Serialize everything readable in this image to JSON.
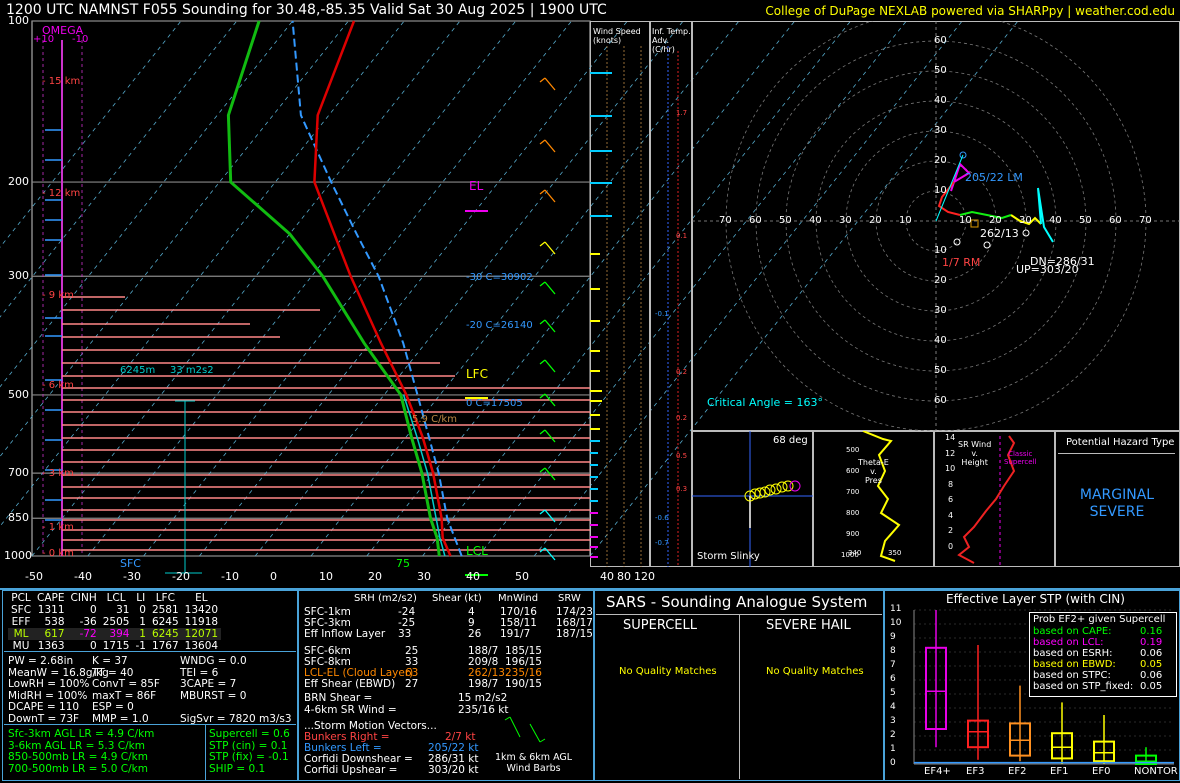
{
  "header": {
    "title": "1200 UTC NAMNST F055 Sounding for 30.48,-85.35 Valid  Sat 30 Aug 2025 | 1900 UTC",
    "credit": "College of DuPage NEXLAB powered via SHARPpy | weather.cod.edu"
  },
  "skewt": {
    "pressure_ticks": [
      "100",
      "200",
      "300",
      "500",
      "700",
      "850",
      "1000"
    ],
    "temp_ticks": [
      "-50",
      "-40",
      "-30",
      "-20",
      "-10",
      "0",
      "10",
      "20",
      "30",
      "40",
      "50"
    ],
    "sfc_label": "SFC",
    "sfc_temp": "75",
    "omega_title": "OMEGA",
    "omega_left": "+10",
    "omega_right": "-10",
    "height_labels": [
      "15 km",
      "12 km",
      "9 km",
      "6 km",
      "3 km",
      "1 km",
      "0 km"
    ],
    "labels": {
      "el": "EL",
      "lfc": "LFC",
      "lcl": "LCL",
      "m30": "-30 C=30902",
      "m20": "-20 C=26140",
      "zero": "0 C=17505",
      "lapse": "5.9 C/km",
      "inflow_depth": "6245m",
      "inflow_srh": "33 m2s2",
      "hail_ticks": [
        "0",
        "10",
        "20",
        "30",
        "30"
      ]
    }
  },
  "wind_speed_panel": {
    "title": "Wind Speed\n(knots)",
    "ticks": [
      "40",
      "80",
      "120"
    ]
  },
  "temp_adv_panel": {
    "title": "Inf. Temp. Adv. (C/hr)",
    "values": [
      "1.7",
      "0.1",
      "-0.1",
      "0.2",
      "0.2",
      "0.5",
      "0.3",
      "-0.6",
      "-0.7"
    ]
  },
  "hodograph": {
    "ring_labels": [
      "60",
      "50",
      "40",
      "30",
      "20",
      "10",
      "10",
      "20",
      "30",
      "40",
      "50",
      "60"
    ],
    "axis_labels": [
      "70",
      "60",
      "50",
      "40",
      "30",
      "20",
      "10",
      "10",
      "20",
      "30",
      "40",
      "50",
      "60",
      "70"
    ],
    "lm": "205/22 LM",
    "mean": "262/13",
    "rm": "1/7 RM",
    "up": "UP=303/20",
    "dn": "DN=286/31",
    "critical_angle": "Critical Angle = 163°"
  },
  "slinky": {
    "title": "Storm Slinky",
    "deg": "68 deg"
  },
  "theta": {
    "title": "Theta-E\nv.\nPres",
    "ticks": [
      "500",
      "600",
      "700",
      "800",
      "900",
      "1000"
    ],
    "xticks": [
      "340",
      "350"
    ]
  },
  "srwind": {
    "title": "SR Wind\nv.\nHeight",
    "ticks": [
      "14",
      "12",
      "10",
      "8",
      "6",
      "4",
      "2",
      "0"
    ],
    "classic": "Classic\nSupercell"
  },
  "hazard": {
    "title": "Potential Hazard Type",
    "value": "MARGINAL\nSEVERE"
  },
  "thermo_table": {
    "headers": [
      "PCL",
      "CAPE",
      "CINH",
      "LCL",
      "LI",
      "LFC",
      "EL"
    ],
    "rows": [
      [
        "SFC",
        "1311",
        "0",
        "31",
        "0",
        "2581",
        "13420"
      ],
      [
        "EFF",
        "538",
        "-36",
        "2505",
        "1",
        "6245",
        "11918"
      ],
      [
        "ML",
        "617",
        "-72",
        "394",
        "1",
        "6245",
        "12071"
      ],
      [
        "MU",
        "1363",
        "0",
        "1715",
        "-1",
        "1767",
        "13604"
      ]
    ]
  },
  "thermo_params": [
    [
      "PW = 2.68in",
      "K = 37",
      "WNDG = 0.0"
    ],
    [
      "MeanW = 16.8g/kg",
      "TT = 40",
      "TEI = 6"
    ],
    [
      "LowRH = 100%",
      "ConvT = 85F",
      "3CAPE = 7"
    ],
    [
      "MidRH = 100%",
      "maxT = 86F",
      "MBURST = 0"
    ],
    [
      "DCAPE = 110",
      "ESP = 0",
      ""
    ],
    [
      "DownT = 73F",
      "MMP = 1.0",
      "SigSvr = 7820 m3/s3"
    ]
  ],
  "lapse_rates": [
    "Sfc-3km AGL LR = 4.9 C/km",
    "3-6km AGL LR = 5.3 C/km",
    "850-500mb LR = 4.9 C/km",
    "700-500mb LR = 5.0 C/km"
  ],
  "composite": [
    "Supercell = 0.6",
    "STP (cin) = 0.1",
    "STP (fix) = -0.1",
    "SHIP = 0.1"
  ],
  "kin_table": {
    "headers": [
      "SRH (m2/s2)",
      "Shear (kt)",
      "MnWind",
      "SRW"
    ],
    "rows": [
      [
        "SFC-1km",
        "-24",
        "4",
        "170/16",
        "174/23"
      ],
      [
        "SFC-3km",
        "-25",
        "9",
        "158/11",
        "168/17"
      ],
      [
        "Eff Inflow Layer",
        "33",
        "26",
        "191/7",
        "187/15"
      ],
      [
        "SFC-6km",
        "25",
        "188/7",
        "185/15",
        ""
      ],
      [
        "SFC-8km",
        "33",
        "209/8",
        "196/15",
        ""
      ],
      [
        "LCL-EL (Cloud Layer)",
        "63",
        "262/13",
        "235/16",
        ""
      ],
      [
        "Eff Shear (EBWD)",
        "27",
        "198/7",
        "190/15",
        ""
      ]
    ]
  },
  "kin_extra": {
    "brn": "BRN Shear =",
    "brn_v": "15 m2/s2",
    "srw46": "4-6km SR Wind =",
    "srw46_v": "235/16 kt",
    "motion_title": "...Storm Motion Vectors...",
    "br": "Bunkers Right =",
    "br_v": "2/7 kt",
    "bl": "Bunkers Left =",
    "bl_v": "205/22 kt",
    "cd": "Corfidi Downshear =",
    "cd_v": "286/31 kt",
    "cu": "Corfidi Upshear =",
    "cu_v": "303/20 kt",
    "barbs": "1km & 6km AGL\nWind Barbs"
  },
  "sars": {
    "title": "SARS - Sounding Analogue System",
    "supercell": "SUPERCELL",
    "hail": "SEVERE HAIL",
    "sup_match": "No Quality Matches",
    "hail_match": "No Quality Matches"
  },
  "stp": {
    "title": "Effective Layer STP (with CIN)",
    "yticks": [
      "11",
      "10",
      "9",
      "8",
      "7",
      "6",
      "5",
      "4",
      "3",
      "2",
      "1",
      "0"
    ],
    "categories": [
      "EF4+",
      "EF3",
      "EF2",
      "EF1",
      "EF0",
      "NONTOR"
    ],
    "legend_title": "Prob EF2+ (conditional on Supercell)",
    "legend_title_vis": "Prob EF2+ given Supercell",
    "legend": [
      [
        "based on CAPE:",
        "0.16"
      ],
      [
        "based on LCL:",
        "0.19"
      ],
      [
        "based on ESRH:",
        "0.06"
      ],
      [
        "based on EBWD:",
        "0.05"
      ],
      [
        "based on STPC:",
        "0.06"
      ],
      [
        "based on STP_fixed:",
        "0.05"
      ]
    ]
  },
  "chart_data": {
    "type": "line",
    "title": "1200 UTC NAMNST F055 Sounding for 30.48,-85.35 Valid  Sat 30 Aug 2025 | 1900 UTC",
    "xlabel": "",
    "ylabel": "",
    "xlim": [
      -50,
      50
    ],
    "ylim_pressure_mb": [
      1000,
      100
    ],
    "series": [
      {
        "values_description": "",
        "points_p_t": [
          [
            1000,
            25
          ],
          [
            925,
            21
          ],
          [
            850,
            18
          ],
          [
            700,
            10
          ],
          [
            600,
            3
          ],
          [
            500,
            -6
          ],
          [
            400,
            -18
          ],
          [
            300,
            -33
          ],
          [
            250,
            -42
          ],
          [
            200,
            -53
          ],
          [
            150,
            -62
          ],
          [
            100,
            -69
          ]
        ]
      },
      {
        "points_p_td": [
          [
            1000,
            23
          ],
          [
            925,
            20
          ],
          [
            850,
            16
          ],
          [
            700,
            8
          ],
          [
            600,
            1
          ],
          [
            500,
            -7
          ],
          [
            400,
            -21
          ],
          [
            300,
            -38
          ],
          [
            250,
            -50
          ],
          [
            200,
            -68
          ],
          [
            150,
            -78
          ],
          [
            100,
            -86
          ]
        ]
      }
    ],
    "stp_boxes": [
      {
        "cat": "EF4+",
        "min": 1.2,
        "q1": 2.5,
        "med": 5.2,
        "q3": 8.3,
        "max": 11,
        "color": "#e600e6"
      },
      {
        "cat": "EF3",
        "min": 0.3,
        "q1": 1.2,
        "med": 2.3,
        "q3": 3.1,
        "max": 8.5,
        "color": "#ff2020"
      },
      {
        "cat": "EF2",
        "min": 0.2,
        "q1": 0.6,
        "med": 1.7,
        "q3": 2.9,
        "max": 5.6,
        "color": "#ff9020"
      },
      {
        "cat": "EF1",
        "min": 0,
        "q1": 0.4,
        "med": 1.2,
        "q3": 2.2,
        "max": 4.4,
        "color": "#ffff00"
      },
      {
        "cat": "EF0",
        "min": 0,
        "q1": 0.2,
        "med": 0.8,
        "q3": 1.6,
        "max": 3.5,
        "color": "#ffff00"
      },
      {
        "cat": "NONTOR",
        "min": 0,
        "q1": 0,
        "med": 0.2,
        "q3": 0.6,
        "max": 1.2,
        "color": "#00ff00"
      }
    ]
  }
}
